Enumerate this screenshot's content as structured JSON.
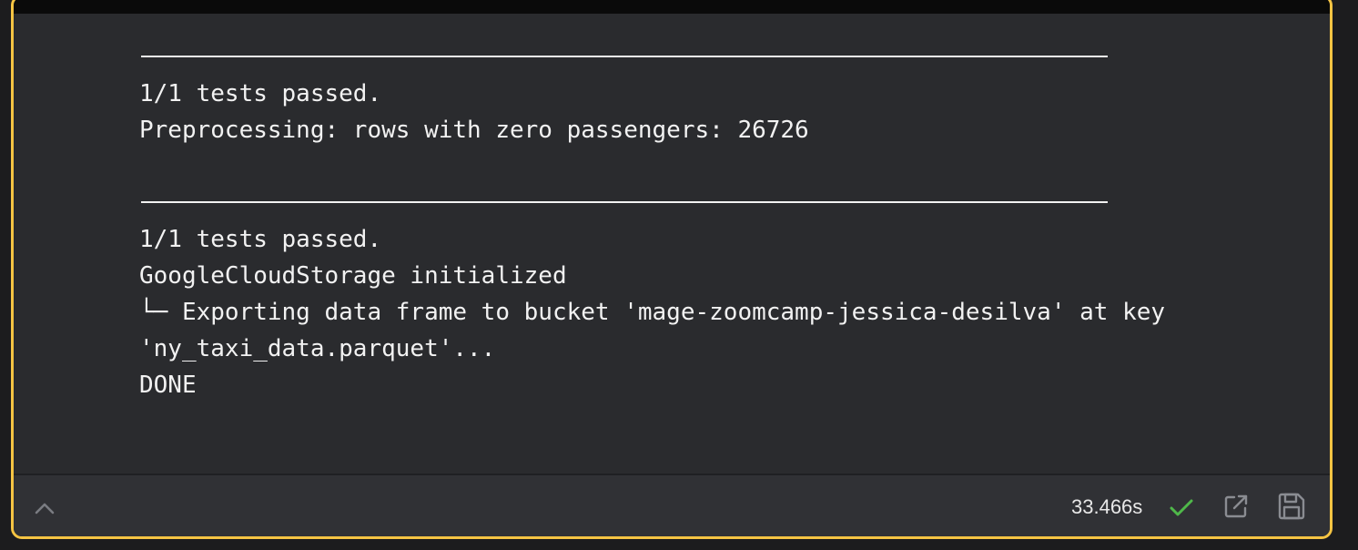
{
  "output": {
    "lines": [
      "1/1 tests passed.",
      "Preprocessing: rows with zero passengers: 26726",
      "1/1 tests passed.",
      "GoogleCloudStorage initialized",
      "└─ Exporting data frame to bucket 'mage-zoomcamp-jessica-desilva' at key",
      "'ny_taxi_data.parquet'...",
      "DONE"
    ]
  },
  "footer": {
    "duration": "33.466s",
    "status_icon": "check-icon",
    "status_color": "#4fb84a",
    "accent_color": "#f5c443"
  }
}
